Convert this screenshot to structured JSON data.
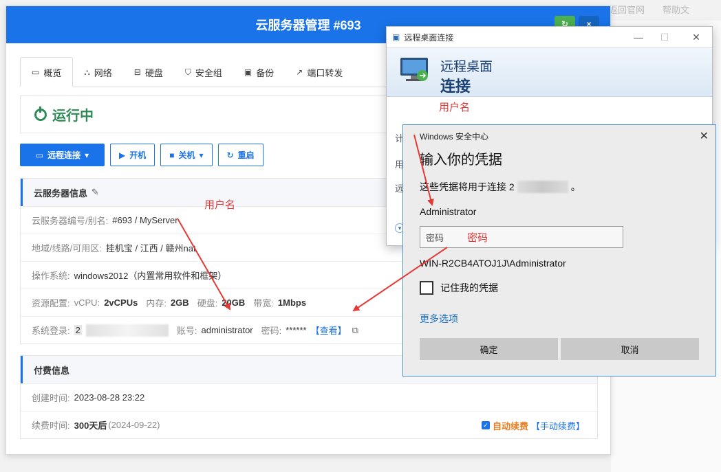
{
  "background": {
    "top_links": [
      "返回官网",
      "帮助文"
    ]
  },
  "main": {
    "title": "云服务器管理 #693",
    "tabs": [
      {
        "label": "概览",
        "icon": "monitor-icon"
      },
      {
        "label": "网络",
        "icon": "network-icon"
      },
      {
        "label": "硬盘",
        "icon": "disk-icon"
      },
      {
        "label": "安全组",
        "icon": "shield-icon"
      },
      {
        "label": "备份",
        "icon": "save-icon"
      },
      {
        "label": "端口转发",
        "icon": "external-link-icon"
      }
    ],
    "status": "运行中",
    "actions": {
      "remote": "远程连接",
      "start": "开机",
      "shutdown": "关机",
      "restart": "重启"
    },
    "info": {
      "title": "云服务器信息",
      "id_label": "云服务器编号/别名:",
      "id_value": "#693 / MyServer",
      "region_label": "地域/线路/可用区:",
      "region_value": "挂机宝 / 江西 / 赣州nat",
      "os_label": "操作系统:",
      "os_value": "windows2012（内置常用软件和框架）",
      "res_label": "资源配置:",
      "res_vcpu_label": "vCPU:",
      "res_vcpu": "2vCPUs",
      "res_mem_label": "内存:",
      "res_mem": "2GB",
      "res_disk_label": "硬盘:",
      "res_disk": "20GB",
      "res_bw_label": "带宽:",
      "res_bw": "1Mbps",
      "login_label": "系统登录:",
      "login_ip_prefix": "2",
      "account_label": "账号:",
      "account_value": "administrator",
      "password_label": "密码:",
      "password_value": "******",
      "view_link": "【查看】"
    },
    "billing": {
      "title": "付费信息",
      "created_label": "创建时间:",
      "created_value": "2023-08-28 23:22",
      "renew_label": "续费时间:",
      "renew_days": "300天后",
      "renew_date": "(2024-09-22)",
      "auto_renew": "自动续费",
      "manual_renew": "【手动续费】"
    }
  },
  "annotations": {
    "username_main": "用户名",
    "username_rdp": "用户名",
    "password": "密码"
  },
  "rdp": {
    "window_title": "远程桌面连接",
    "banner_line1": "远程桌面",
    "banner_line2": "连接",
    "body_letters": [
      "计",
      "用",
      "远"
    ]
  },
  "cred": {
    "window_title": "Windows 安全中心",
    "heading": "输入你的凭据",
    "desc_prefix": "这些凭据将用于连接 2",
    "desc_suffix": "。",
    "username": "Administrator",
    "password_placeholder": "密码",
    "domain_user": "WIN-R2CB4ATOJ1J\\Administrator",
    "remember": "记住我的凭据",
    "more_options": "更多选项",
    "ok": "确定",
    "cancel": "取消"
  },
  "colors": {
    "primary": "#1a73e8",
    "running": "#2e8b57",
    "annotation": "#e53935",
    "autorenew": "#e67e22"
  }
}
